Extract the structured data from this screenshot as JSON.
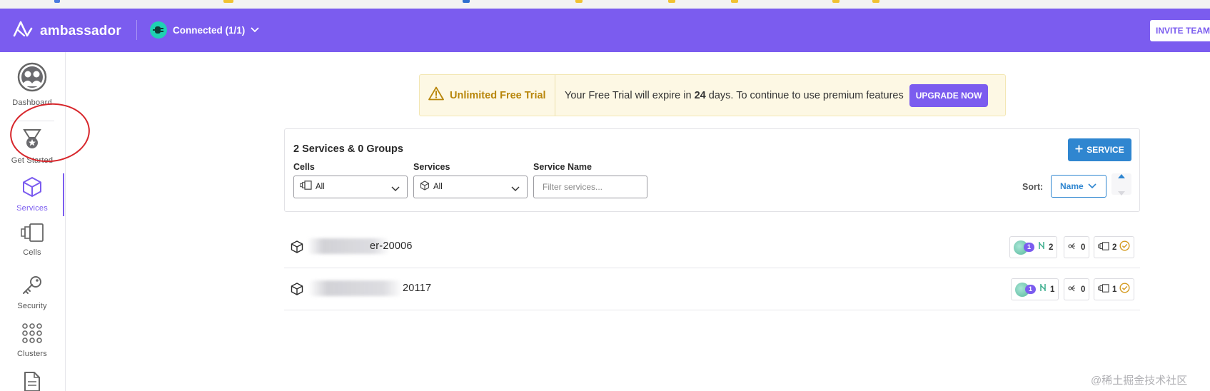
{
  "header": {
    "brand": "ambassador",
    "connection": "Connected (1/1)",
    "invite_label": "INVITE TEAM"
  },
  "sidebar": {
    "items": [
      {
        "label": "Dashboard"
      },
      {
        "label": "Get Started"
      },
      {
        "label": "Services",
        "active": true
      },
      {
        "label": "Cells"
      },
      {
        "label": "Security"
      },
      {
        "label": "Clusters"
      }
    ]
  },
  "trial": {
    "title": "Unlimited Free Trial",
    "message_prefix": "Your Free Trial will expire in",
    "days": "24",
    "message_suffix": "days. To continue to use premium features",
    "upgrade_label": "UPGRADE NOW"
  },
  "filters": {
    "summary": "2 Services & 0 Groups",
    "cells_label": "Cells",
    "cells_value": "All",
    "services_label": "Services",
    "services_value": "All",
    "name_label": "Service Name",
    "name_placeholder": "Filter services...",
    "add_service_label": "SERVICE",
    "sort_label": "Sort:",
    "sort_value": "Name"
  },
  "services": [
    {
      "name": "er-20006",
      "clusters": "1",
      "ports": "2",
      "links": "0",
      "cells": "2"
    },
    {
      "name": "20117",
      "clusters": "1",
      "ports": "1",
      "links": "0",
      "cells": "1"
    }
  ],
  "watermark": "@稀土掘金技术社区",
  "colors": {
    "brand": "#7b5cef",
    "primary_blue": "#2f86d0",
    "trial_bg": "#fdf8e4",
    "trial_title": "#b8860b",
    "connected": "#1fd1b2",
    "annotation": "#d7262b"
  }
}
